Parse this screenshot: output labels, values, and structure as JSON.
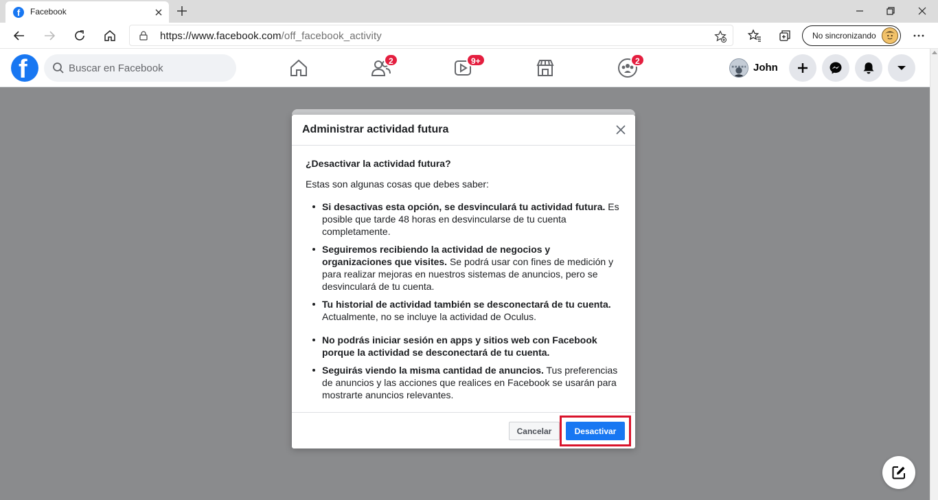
{
  "browser": {
    "tab_title": "Facebook",
    "url_host": "https://www.facebook.com",
    "url_path": "/off_facebook_activity",
    "sync_label": "No sincronizando"
  },
  "facebook": {
    "logo_letter": "f",
    "search_placeholder": "Buscar en Facebook",
    "badges": {
      "friends": "2",
      "watch": "9+",
      "groups": "2"
    },
    "profile_name": "John",
    "brand_color": "#1877f2",
    "badge_color": "#e41e3f"
  },
  "modal": {
    "title": "Administrar actividad futura",
    "question": "¿Desactivar la actividad futura?",
    "intro": "Estas son algunas cosas que debes saber:",
    "bullets": [
      {
        "bold": "Si desactivas esta opción, se desvinculará tu actividad futura.",
        "text": " Es posible que tarde 48 horas en desvincularse de tu cuenta completamente."
      },
      {
        "bold": "Seguiremos recibiendo la actividad de negocios y organizaciones que visites.",
        "text": " Se podrá usar con fines de medición y para realizar mejoras en nuestros sistemas de anuncios, pero se desvinculará de tu cuenta."
      },
      {
        "bold": "Tu historial de actividad también se desconectará de tu cuenta.",
        "text": " Actualmente, no se incluye la actividad de Oculus."
      },
      {
        "bold": "No podrás iniciar sesión en apps y sitios web con Facebook porque la actividad se desconectará de tu cuenta.",
        "text": ""
      },
      {
        "bold": "Seguirás viendo la misma cantidad de anuncios.",
        "text": " Tus preferencias de anuncios y las acciones que realices en Facebook se usarán para mostrarte anuncios relevantes."
      }
    ],
    "cancel_label": "Cancelar",
    "confirm_label": "Desactivar",
    "highlight_color": "#d9132b"
  }
}
